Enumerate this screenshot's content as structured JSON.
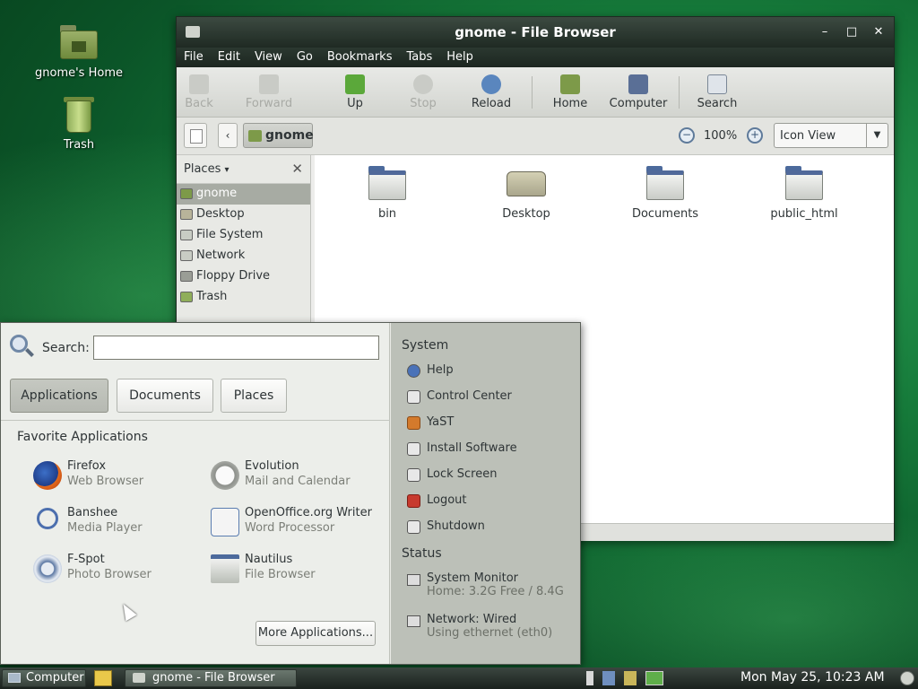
{
  "desktop": {
    "icons": [
      {
        "label": "gnome's Home",
        "icon": "home-folder-icon"
      },
      {
        "label": "Trash",
        "icon": "trash-icon"
      }
    ]
  },
  "window": {
    "title": "gnome - File Browser",
    "controls": {
      "minimize": "–",
      "maximize": "□",
      "close": "✕"
    },
    "menu": [
      "File",
      "Edit",
      "View",
      "Go",
      "Bookmarks",
      "Tabs",
      "Help"
    ],
    "toolbar": {
      "back": "Back",
      "forward": "Forward",
      "up": "Up",
      "stop": "Stop",
      "reload": "Reload",
      "home": "Home",
      "computer": "Computer",
      "search": "Search"
    },
    "location": {
      "crumb": "gnome",
      "zoom": "100%",
      "view_mode": "Icon View"
    },
    "sidepane": {
      "header": "Places",
      "items": [
        {
          "label": "gnome",
          "icon": "home-folder-icon",
          "selected": true
        },
        {
          "label": "Desktop",
          "icon": "desktop-icon",
          "selected": false
        },
        {
          "label": "File System",
          "icon": "drive-icon",
          "selected": false
        },
        {
          "label": "Network",
          "icon": "network-icon",
          "selected": false
        },
        {
          "label": "Floppy Drive",
          "icon": "floppy-icon",
          "selected": false
        },
        {
          "label": "Trash",
          "icon": "trash-icon",
          "selected": false
        }
      ]
    },
    "files": [
      {
        "label": "bin",
        "icon": "folder-icon"
      },
      {
        "label": "Desktop",
        "icon": "desktop-icon"
      },
      {
        "label": "Documents",
        "icon": "folder-icon"
      },
      {
        "label": "public_html",
        "icon": "folder-icon"
      }
    ]
  },
  "app_menu": {
    "search_label": "Search:",
    "search_value": "",
    "tabs": [
      "Applications",
      "Documents",
      "Places"
    ],
    "active_tab": "Applications",
    "favorites_title": "Favorite Applications",
    "favorites": [
      {
        "name": "Firefox",
        "desc": "Web Browser",
        "icon": "firefox-icon"
      },
      {
        "name": "Evolution",
        "desc": "Mail and Calendar",
        "icon": "evolution-icon"
      },
      {
        "name": "Banshee",
        "desc": "Media Player",
        "icon": "banshee-icon"
      },
      {
        "name": "OpenOffice.org Writer",
        "desc": "Word Processor",
        "icon": "writer-icon"
      },
      {
        "name": "F-Spot",
        "desc": "Photo Browser",
        "icon": "fspot-icon"
      },
      {
        "name": "Nautilus",
        "desc": "File Browser",
        "icon": "nautilus-icon"
      }
    ],
    "more_button": "More Applications...",
    "system_title": "System",
    "system_items": [
      {
        "label": "Help",
        "icon": "help-icon"
      },
      {
        "label": "Control Center",
        "icon": "control-center-icon"
      },
      {
        "label": "YaST",
        "icon": "yast-icon"
      },
      {
        "label": "Install Software",
        "icon": "install-icon"
      },
      {
        "label": "Lock Screen",
        "icon": "lock-icon"
      },
      {
        "label": "Logout",
        "icon": "logout-icon"
      },
      {
        "label": "Shutdown",
        "icon": "shutdown-icon"
      }
    ],
    "status_title": "Status",
    "status_items": [
      {
        "label": "System Monitor",
        "sub": "Home: 3.2G Free / 8.4G",
        "icon": "system-monitor-icon"
      },
      {
        "label": "Network: Wired",
        "sub": "Using ethernet (eth0)",
        "icon": "network-wired-icon"
      }
    ]
  },
  "taskbar": {
    "computer": "Computer",
    "task": "gnome - File Browser",
    "clock": "Mon May 25, 10:23 AM"
  }
}
